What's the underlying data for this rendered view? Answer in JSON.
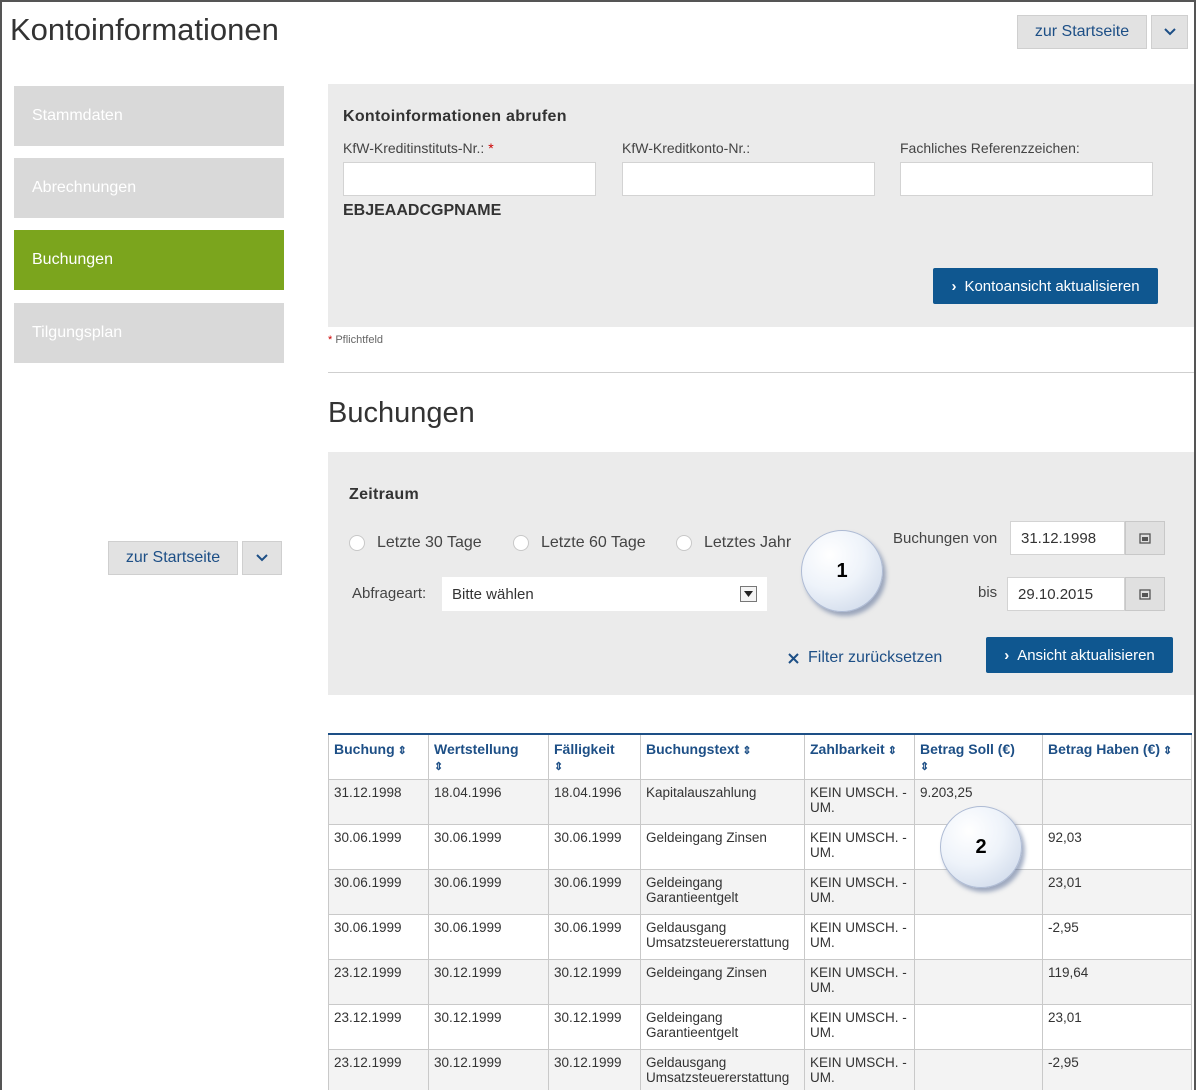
{
  "header": {
    "title": "Kontoinformationen",
    "home_label": "zur Startseite"
  },
  "sidebar": {
    "items": [
      {
        "label": "Stammdaten",
        "active": false
      },
      {
        "label": "Abrechnungen",
        "active": false
      },
      {
        "label": "Buchungen",
        "active": true
      },
      {
        "label": "Tilgungsplan",
        "active": false
      }
    ],
    "home_label": "zur Startseite"
  },
  "account_panel": {
    "title": "Kontoinformationen abrufen",
    "institute_label": "KfW-Kreditinstituts-Nr.:",
    "account_label": "KfW-Kreditkonto-Nr.:",
    "reference_label": "Fachliches Referenzzeichen:",
    "institute_value": "",
    "account_value": "",
    "reference_value": "",
    "institute_name": "EBJEAADCGPNAME",
    "refresh_label": "Kontoansicht aktualisieren",
    "required_note": "Pflichtfeld",
    "required_mark": "*"
  },
  "bookings": {
    "heading": "Buchungen",
    "filter": {
      "title": "Zeitraum",
      "radios": [
        "Letzte 30 Tage",
        "Letzte 60 Tage",
        "Letztes Jahr"
      ],
      "from_label": "Buchungen von",
      "from_value": "31.12.1998",
      "to_label": "bis",
      "to_value": "29.10.2015",
      "query_label": "Abfrageart:",
      "query_value": "Bitte wählen",
      "reset_label": "Filter zurücksetzen",
      "update_label": "Ansicht aktualisieren"
    },
    "columns": [
      "Buchung",
      "Wertstellung",
      "Fälligkeit",
      "Buchungstext",
      "Zahlbarkeit",
      "Betrag Soll (€)",
      "Betrag Haben (€)"
    ],
    "rows": [
      [
        "31.12.1998",
        "18.04.1996",
        "18.04.1996",
        "Kapitalauszahlung",
        "KEIN UMSCH. -UM.",
        "9.203,25",
        ""
      ],
      [
        "30.06.1999",
        "30.06.1999",
        "30.06.1999",
        "Geldeingang Zinsen",
        "KEIN UMSCH. -UM.",
        "",
        "92,03"
      ],
      [
        "30.06.1999",
        "30.06.1999",
        "30.06.1999",
        "Geldeingang Garantieentgelt",
        "KEIN UMSCH. -UM.",
        "",
        "23,01"
      ],
      [
        "30.06.1999",
        "30.06.1999",
        "30.06.1999",
        "Geldausgang Umsatzsteuererstattung",
        "KEIN UMSCH. -UM.",
        "",
        "-2,95"
      ],
      [
        "23.12.1999",
        "30.12.1999",
        "30.12.1999",
        "Geldeingang Zinsen",
        "KEIN UMSCH. -UM.",
        "",
        "119,64"
      ],
      [
        "23.12.1999",
        "30.12.1999",
        "30.12.1999",
        "Geldeingang Garantieentgelt",
        "KEIN UMSCH. -UM.",
        "",
        "23,01"
      ],
      [
        "23.12.1999",
        "30.12.1999",
        "30.12.1999",
        "Geldausgang Umsatzsteuererstattung",
        "KEIN UMSCH. -UM.",
        "",
        "-2,95"
      ]
    ]
  },
  "callouts": {
    "one": "1",
    "two": "2"
  },
  "colors": {
    "accent_green": "#7ba51d",
    "primary_blue": "#0f5790",
    "negative_red": "#e00000"
  },
  "icons": {
    "chevron": "chevron-down-icon",
    "calendar": "calendar-icon",
    "close": "close-icon",
    "sort": "sort-icon"
  }
}
